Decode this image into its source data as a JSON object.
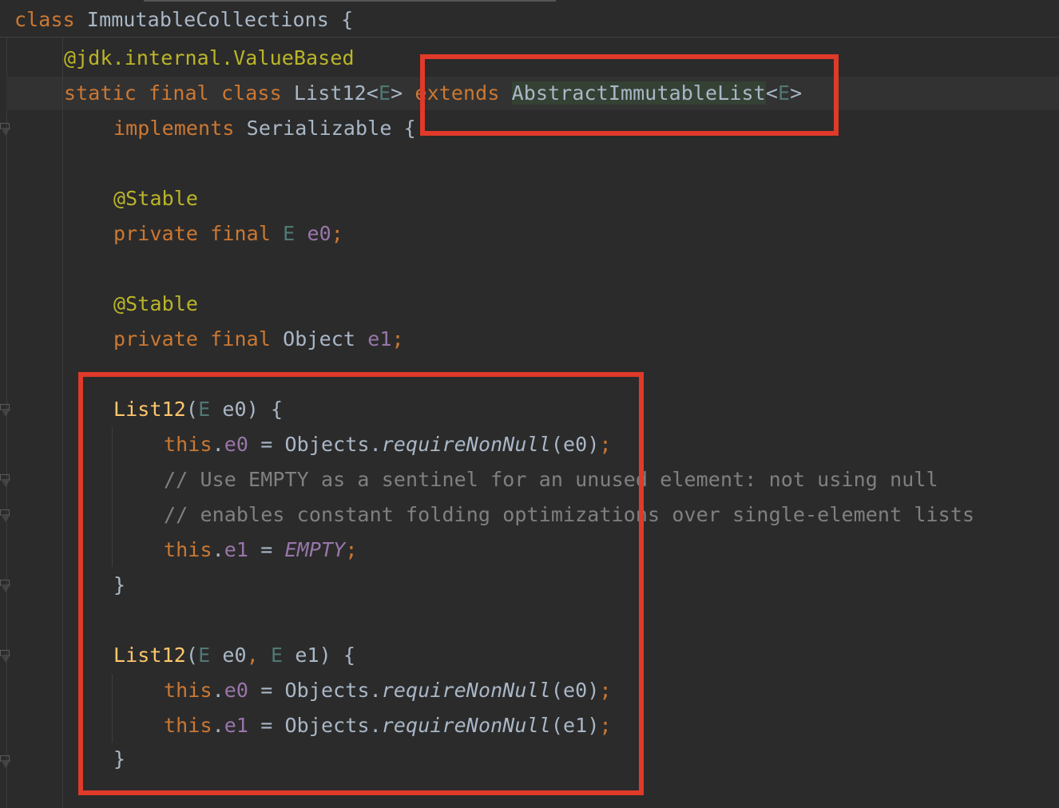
{
  "editor": {
    "lines": [
      {
        "tokens": [
          {
            "t": "class",
            "c": "kw"
          },
          {
            "t": " ImmutableCollections {",
            "c": "plain"
          }
        ]
      },
      {
        "tokens": [
          {
            "t": "@jdk.internal.",
            "c": "ann"
          },
          {
            "t": "ValueBased",
            "c": "ann"
          }
        ]
      },
      {
        "tokens": [
          {
            "t": "static final class",
            "c": "kw"
          },
          {
            "t": " List12<",
            "c": "plain"
          },
          {
            "t": "E",
            "c": "typeparam"
          },
          {
            "t": "> ",
            "c": "plain"
          },
          {
            "t": "extends",
            "c": "kw"
          },
          {
            "t": " ",
            "c": "plain"
          },
          {
            "t": "AbstractImmutableList",
            "c": "plain supertype-hl"
          },
          {
            "t": "<",
            "c": "plain"
          },
          {
            "t": "E",
            "c": "typeparam"
          },
          {
            "t": ">",
            "c": "plain"
          }
        ]
      },
      {
        "tokens": [
          {
            "t": "implements",
            "c": "kw"
          },
          {
            "t": " Serializable {",
            "c": "plain"
          }
        ]
      },
      {
        "tokens": []
      },
      {
        "tokens": [
          {
            "t": "@Stable",
            "c": "ann"
          }
        ]
      },
      {
        "tokens": [
          {
            "t": "private final",
            "c": "kw"
          },
          {
            "t": " ",
            "c": "plain"
          },
          {
            "t": "E",
            "c": "typeparam"
          },
          {
            "t": " ",
            "c": "plain"
          },
          {
            "t": "e0",
            "c": "fld"
          },
          {
            "t": ";",
            "c": "kw"
          }
        ]
      },
      {
        "tokens": []
      },
      {
        "tokens": [
          {
            "t": "@Stable",
            "c": "ann"
          }
        ]
      },
      {
        "tokens": [
          {
            "t": "private final",
            "c": "kw"
          },
          {
            "t": " Object ",
            "c": "plain"
          },
          {
            "t": "e1",
            "c": "fld"
          },
          {
            "t": ";",
            "c": "kw"
          }
        ]
      },
      {
        "tokens": []
      },
      {
        "tokens": [
          {
            "t": "List12",
            "c": "fn"
          },
          {
            "t": "(",
            "c": "plain"
          },
          {
            "t": "E",
            "c": "typeparam"
          },
          {
            "t": " e0) {",
            "c": "plain"
          }
        ]
      },
      {
        "tokens": [
          {
            "t": "this",
            "c": "kw"
          },
          {
            "t": ".",
            "c": "plain"
          },
          {
            "t": "e0",
            "c": "fld"
          },
          {
            "t": " = Objects.",
            "c": "plain"
          },
          {
            "t": "requireNonNull",
            "c": "plain italic"
          },
          {
            "t": "(e0)",
            "c": "plain"
          },
          {
            "t": ";",
            "c": "kw"
          }
        ]
      },
      {
        "tokens": [
          {
            "t": "// Use EMPTY as a sentinel for an unused element: not using null",
            "c": "cmt"
          }
        ]
      },
      {
        "tokens": [
          {
            "t": "// enables constant folding optimizations over single-element lists",
            "c": "cmt"
          }
        ]
      },
      {
        "tokens": [
          {
            "t": "this",
            "c": "kw"
          },
          {
            "t": ".",
            "c": "plain"
          },
          {
            "t": "e1",
            "c": "fld"
          },
          {
            "t": " = ",
            "c": "plain"
          },
          {
            "t": "EMPTY",
            "c": "static-field"
          },
          {
            "t": ";",
            "c": "kw"
          }
        ]
      },
      {
        "tokens": [
          {
            "t": "}",
            "c": "plain"
          }
        ]
      },
      {
        "tokens": []
      },
      {
        "tokens": [
          {
            "t": "List12",
            "c": "fn"
          },
          {
            "t": "(",
            "c": "plain"
          },
          {
            "t": "E",
            "c": "typeparam"
          },
          {
            "t": " e0",
            "c": "plain"
          },
          {
            "t": ", ",
            "c": "kw"
          },
          {
            "t": "E",
            "c": "typeparam"
          },
          {
            "t": " e1) {",
            "c": "plain"
          }
        ]
      },
      {
        "tokens": [
          {
            "t": "this",
            "c": "kw"
          },
          {
            "t": ".",
            "c": "plain"
          },
          {
            "t": "e0",
            "c": "fld"
          },
          {
            "t": " = Objects.",
            "c": "plain"
          },
          {
            "t": "requireNonNull",
            "c": "plain italic"
          },
          {
            "t": "(e0)",
            "c": "plain"
          },
          {
            "t": ";",
            "c": "kw"
          }
        ]
      },
      {
        "tokens": [
          {
            "t": "this",
            "c": "kw"
          },
          {
            "t": ".",
            "c": "plain"
          },
          {
            "t": "e1",
            "c": "fld"
          },
          {
            "t": " = Objects.",
            "c": "plain"
          },
          {
            "t": "requireNonNull",
            "c": "plain italic"
          },
          {
            "t": "(e1)",
            "c": "plain"
          },
          {
            "t": ";",
            "c": "kw"
          }
        ]
      },
      {
        "tokens": [
          {
            "t": "}",
            "c": "plain"
          }
        ]
      }
    ]
  },
  "colors": {
    "background": "#2b2b2b",
    "keyword": "#cc7832",
    "annotation": "#bbb529",
    "field": "#9876aa",
    "method_decl": "#ffc66d",
    "comment": "#808080",
    "highlight_box": "#e03a2a"
  },
  "icons": [
    "fold-marker-icon"
  ]
}
